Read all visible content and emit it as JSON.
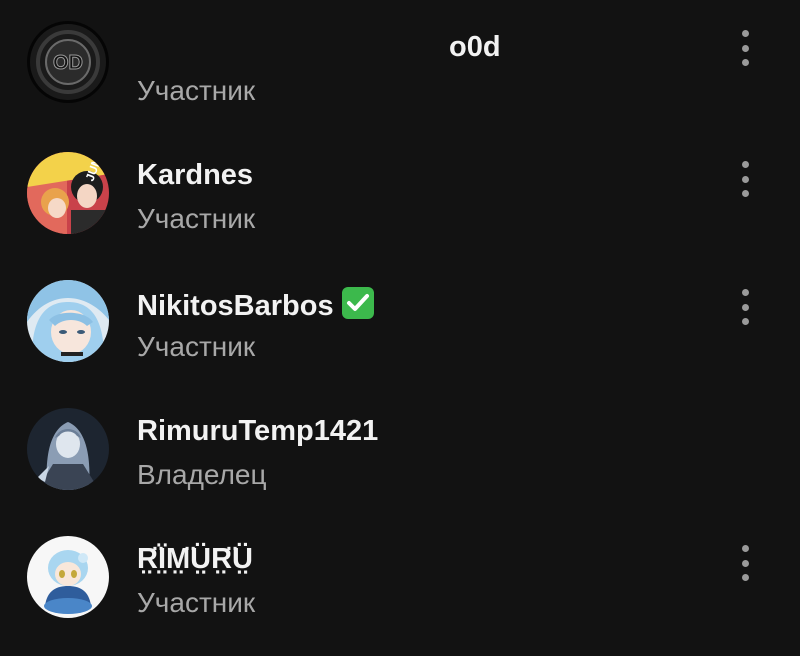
{
  "members": [
    {
      "name": "o0d",
      "role": "Участник",
      "avatar_label": "OD"
    },
    {
      "name": "Kardnes",
      "role": "Участник"
    },
    {
      "name": "NikitosBarbos",
      "role": "Участник",
      "verified_badge": "check-mark-emoji"
    },
    {
      "name": "RimuruTemp1421",
      "role": "Владелец"
    },
    {
      "name": "R̤̈Ï̤M̤̈Ṳ̈R̤̈Ṳ̈",
      "role": "Участник"
    }
  ],
  "colors": {
    "background": "#121212",
    "name": "#f2f2f2",
    "role": "#a8a8a8",
    "menu_dots": "#9a9a9a",
    "verified": "#3cb94c"
  }
}
